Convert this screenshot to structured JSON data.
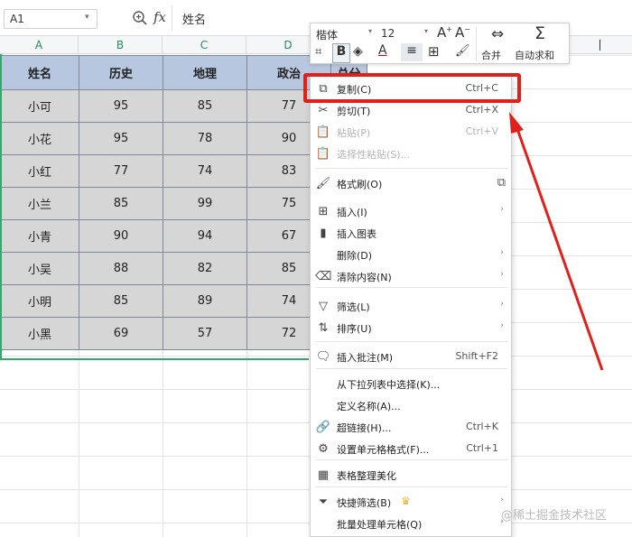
{
  "formula_bar": {
    "cell_ref": "A1",
    "fx": "fx",
    "content": "姓名"
  },
  "columns": [
    "A",
    "B",
    "C",
    "D"
  ],
  "table": {
    "headers": [
      "姓名",
      "历史",
      "地理",
      "政治",
      "总分"
    ],
    "rows": [
      [
        "小可",
        "95",
        "85",
        "77"
      ],
      [
        "小花",
        "95",
        "78",
        "90"
      ],
      [
        "小红",
        "77",
        "74",
        "83"
      ],
      [
        "小兰",
        "85",
        "99",
        "75"
      ],
      [
        "小青",
        "90",
        "94",
        "67"
      ],
      [
        "小吴",
        "88",
        "82",
        "85"
      ],
      [
        "小明",
        "85",
        "89",
        "74"
      ],
      [
        "小黑",
        "69",
        "57",
        "72"
      ]
    ]
  },
  "mini_toolbar": {
    "font": "楷体",
    "size": "12",
    "merge": "合并",
    "autosum": "自动求和"
  },
  "menu": [
    {
      "label": "复制(C)",
      "shortcut": "Ctrl+C",
      "icon": "copy-icon",
      "glyph": "⧉"
    },
    {
      "label": "剪切(T)",
      "shortcut": "Ctrl+X",
      "icon": "scissors-icon",
      "glyph": "✂"
    },
    {
      "label": "粘贴(P)",
      "shortcut": "Ctrl+V",
      "icon": "paste-icon",
      "glyph": "📋",
      "disabled": true
    },
    {
      "label": "选择性粘贴(S)...",
      "icon": "paste-special-icon",
      "glyph": "📋",
      "disabled": true
    },
    {
      "label": "格式刷(O)",
      "icon": "format-painter-icon",
      "glyph": "🖌"
    },
    {
      "label": "插入(I)",
      "icon": "insert-icon",
      "glyph": "⊞",
      "submenu": true
    },
    {
      "label": "插入图表",
      "icon": "chart-icon",
      "glyph": "▮"
    },
    {
      "label": "删除(D)",
      "icon": "",
      "glyph": "",
      "submenu": true
    },
    {
      "label": "清除内容(N)",
      "icon": "eraser-icon",
      "glyph": "⌫",
      "submenu": true
    },
    {
      "label": "筛选(L)",
      "icon": "filter-icon",
      "glyph": "▽",
      "submenu": true
    },
    {
      "label": "排序(U)",
      "icon": "sort-icon",
      "glyph": "⇅",
      "submenu": true
    },
    {
      "label": "插入批注(M)",
      "shortcut": "Shift+F2",
      "icon": "comment-icon",
      "glyph": "🗨"
    },
    {
      "label": "从下拉列表中选择(K)...",
      "icon": "",
      "glyph": ""
    },
    {
      "label": "定义名称(A)...",
      "icon": "",
      "glyph": ""
    },
    {
      "label": "超链接(H)...",
      "shortcut": "Ctrl+K",
      "icon": "link-icon",
      "glyph": "🔗"
    },
    {
      "label": "设置单元格格式(F)...",
      "shortcut": "Ctrl+1",
      "icon": "cell-format-icon",
      "glyph": "⚙"
    },
    {
      "label": "表格整理美化",
      "icon": "table-beautify-icon",
      "glyph": "▦"
    },
    {
      "label": "快捷筛选(B)",
      "icon": "quick-filter-icon",
      "glyph": "⏷",
      "submenu": true,
      "badge": "crown-icon"
    },
    {
      "label": "批量处理单元格(Q)",
      "icon": "",
      "glyph": "",
      "submenu": true
    }
  ],
  "watermark": "@稀土掘金技术社区",
  "colors": {
    "highlight": "#e0201b",
    "header_bg": "#b8c7e0",
    "cell_bg": "#d6d6d6",
    "accent_green": "#36a86b"
  }
}
